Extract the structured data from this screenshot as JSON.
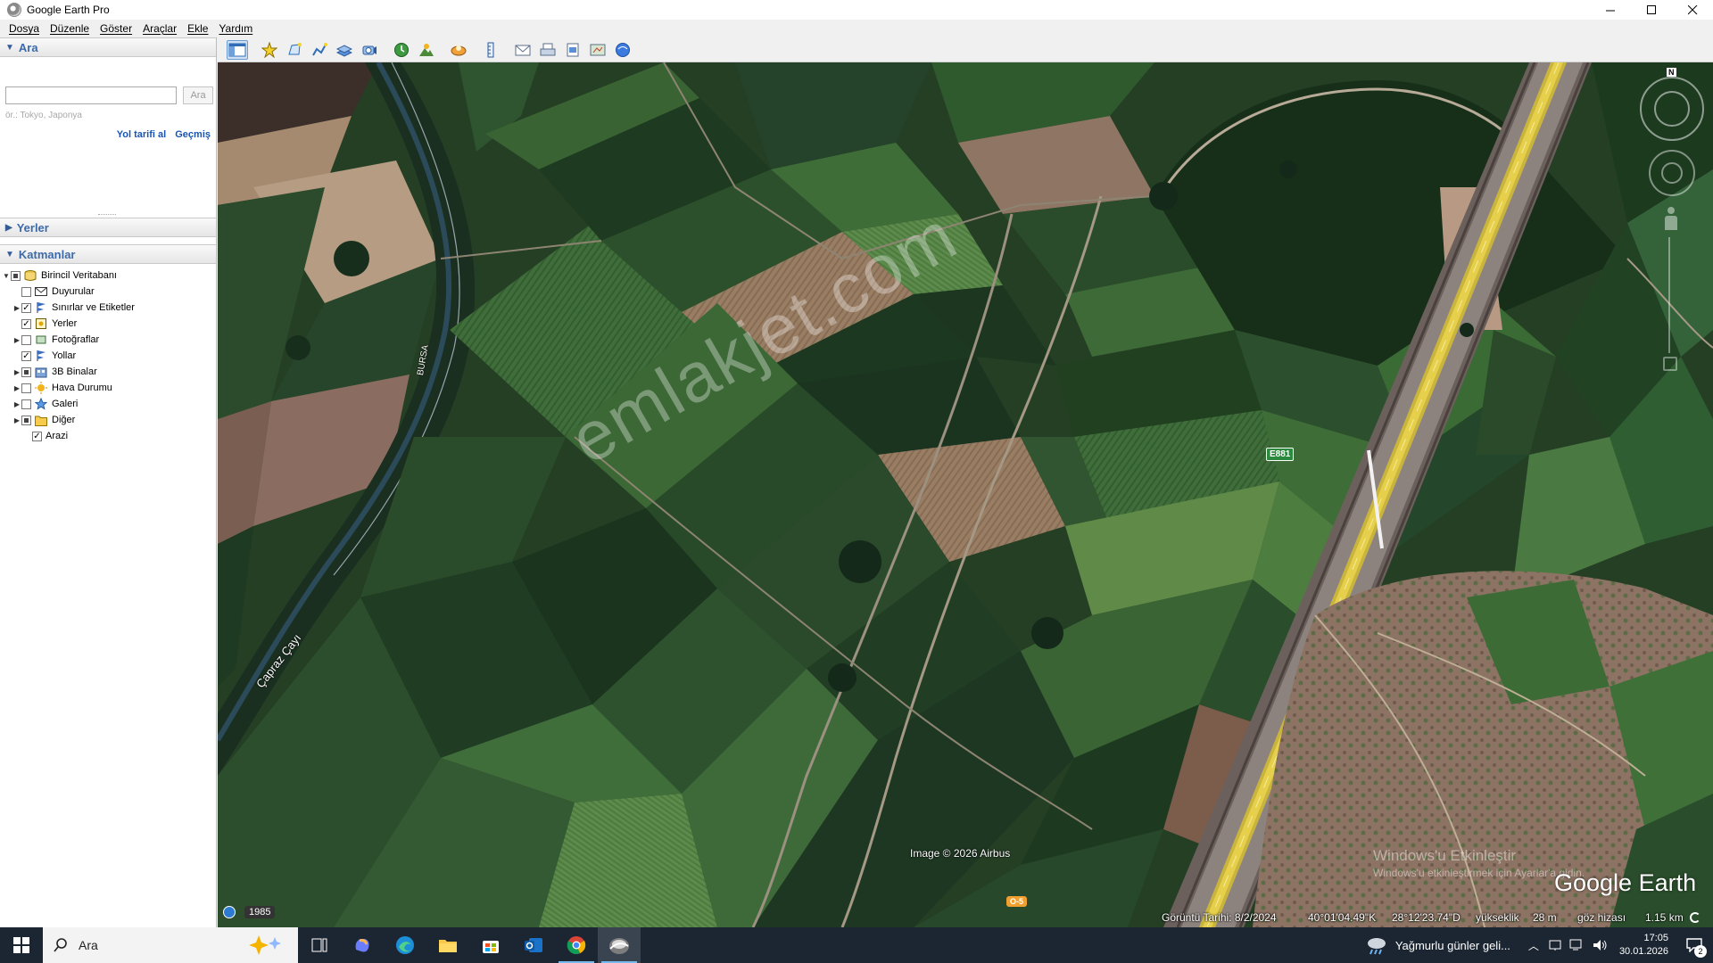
{
  "window": {
    "title": "Google Earth Pro",
    "controls": [
      "minimize",
      "maximize",
      "close"
    ]
  },
  "menu": [
    "Dosya",
    "Düzenle",
    "Göster",
    "Araçlar",
    "Ekle",
    "Yardım"
  ],
  "search_panel": {
    "header": "Ara",
    "input_value": "",
    "button_label": "Ara",
    "hint": "ör.: Tokyo, Japonya",
    "link_directions": "Yol tarifi al",
    "link_history": "Geçmiş"
  },
  "places_panel": {
    "header": "Yerler"
  },
  "layers_panel": {
    "header": "Katmanlar",
    "items": [
      {
        "label": "Birincil Veritabanı",
        "checked": "partial",
        "expandable": true,
        "expanded": true,
        "indent": 0,
        "icon": "database-icon"
      },
      {
        "label": "Duyurular",
        "checked": "no",
        "expandable": false,
        "indent": 1,
        "icon": "envelope-icon"
      },
      {
        "label": "Sınırlar ve Etiketler",
        "checked": "yes",
        "expandable": true,
        "indent": 1,
        "icon": "flag-icon"
      },
      {
        "label": "Yerler",
        "checked": "yes",
        "expandable": false,
        "indent": 1,
        "icon": "places-icon"
      },
      {
        "label": "Fotoğraflar",
        "checked": "no",
        "expandable": true,
        "indent": 1,
        "icon": "photo-icon"
      },
      {
        "label": "Yollar",
        "checked": "yes",
        "expandable": false,
        "indent": 1,
        "icon": "road-icon"
      },
      {
        "label": "3B Binalar",
        "checked": "partial",
        "expandable": true,
        "indent": 1,
        "icon": "building-icon"
      },
      {
        "label": "Hava Durumu",
        "checked": "no",
        "expandable": true,
        "indent": 1,
        "icon": "weather-icon"
      },
      {
        "label": "Galeri",
        "checked": "no",
        "expandable": true,
        "indent": 1,
        "icon": "star-icon"
      },
      {
        "label": "Diğer",
        "checked": "partial",
        "expandable": true,
        "indent": 1,
        "icon": "folder-icon"
      },
      {
        "label": "Arazi",
        "checked": "yes",
        "expandable": false,
        "indent": 0,
        "icon": "none"
      }
    ]
  },
  "toolbar": [
    "sidebar-toggle-icon",
    "placemark-icon",
    "polygon-icon",
    "path-icon",
    "image-overlay-icon",
    "record-tour-icon",
    "historical-imagery-icon",
    "sunlight-icon",
    "planets-icon",
    "ruler-icon",
    "email-icon",
    "print-icon",
    "save-image-icon",
    "map-view-icon",
    "google-maps-icon"
  ],
  "map": {
    "watermark": "emlakjet.com",
    "road_label_bursa": "BURSA",
    "river_label": "Çapraz Çayı",
    "highway_shield": "E881",
    "road_shield_bottom": "O-5",
    "credit": "Image © 2026 Airbus",
    "activation_line1": "Windows'u Etkinleştir",
    "activation_line2": "Windows'u etkinleştirmek için Ayarlar'a gidin.",
    "brand": "Google Earth",
    "north_label": "N",
    "timeline_year": "1985"
  },
  "status": {
    "imagery_date": "Görüntü Tarihi: 8/2/2024",
    "lat": "40°01'04.49\"K",
    "lon": "28°12'23.74\"D",
    "elevation_label": "yükseklik",
    "elevation_value": "28 m",
    "eye_label": "göz hizası",
    "eye_value": "1.15 km"
  },
  "taskbar": {
    "search_placeholder": "Ara",
    "weather_text": "Yağmurlu günler geli...",
    "time": "17:05",
    "date": "30.01.2026",
    "notifications": "2"
  }
}
